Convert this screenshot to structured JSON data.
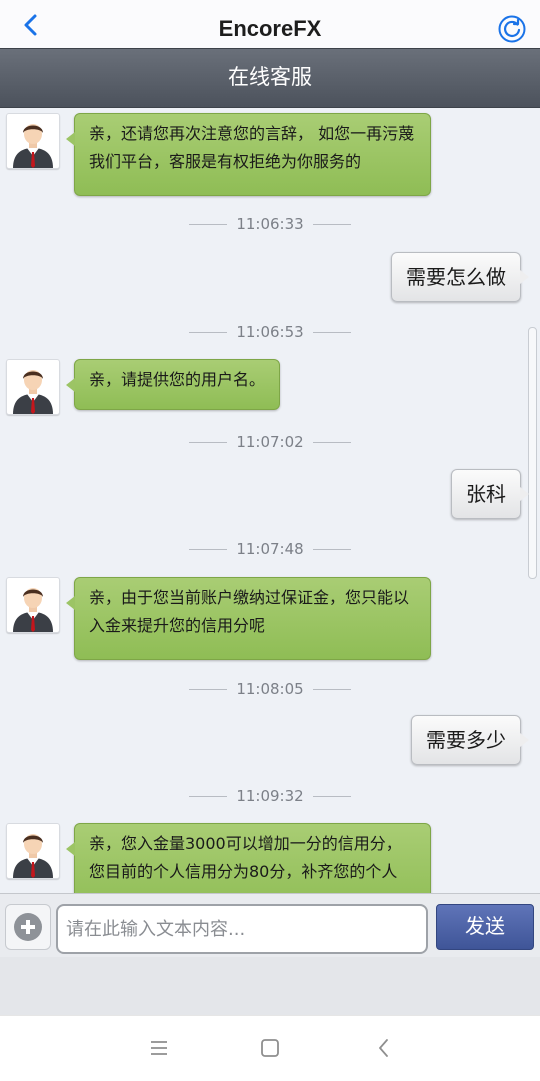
{
  "app": {
    "title": "EncoreFX",
    "back_icon": "chevron-left-icon",
    "refresh_icon": "refresh-icon"
  },
  "header": {
    "title": "在线客服"
  },
  "messages": [
    {
      "side": "in",
      "text": "亲，还请您再次注意您的言辞， 如您一再污蔑我们平台，客服是有权拒绝为你服务的"
    },
    {
      "side": "time",
      "text": "11:06:33"
    },
    {
      "side": "out",
      "text": "需要怎么做"
    },
    {
      "side": "time",
      "text": "11:06:53"
    },
    {
      "side": "in",
      "text": "亲，请提供您的用户名。"
    },
    {
      "side": "time",
      "text": "11:07:02"
    },
    {
      "side": "out",
      "text": "张科"
    },
    {
      "side": "time",
      "text": "11:07:48"
    },
    {
      "side": "in",
      "text": "亲，由于您当前账户缴纳过保证金，您只能以入金来提升您的信用分呢"
    },
    {
      "side": "time",
      "text": "11:08:05"
    },
    {
      "side": "out",
      "text": "需要多少"
    },
    {
      "side": "time",
      "text": "11:09:32"
    },
    {
      "side": "in",
      "text": "亲，您入金量3000可以增加一分的信用分，您目前的个人信用分为80分，补齐您的个人"
    }
  ],
  "composer": {
    "placeholder": "请在此输入文本内容...",
    "value": "",
    "send_label": "发送",
    "plus_icon": "plus-circle-icon"
  },
  "system_nav": {
    "icons": [
      "menu-icon",
      "home-square-icon",
      "back-chevron-icon"
    ]
  },
  "colors": {
    "agent_bubble": "#9cc465",
    "user_bubble": "#eeeeef",
    "send_button": "#4a5fa3",
    "header_bar": "#5b616b"
  }
}
